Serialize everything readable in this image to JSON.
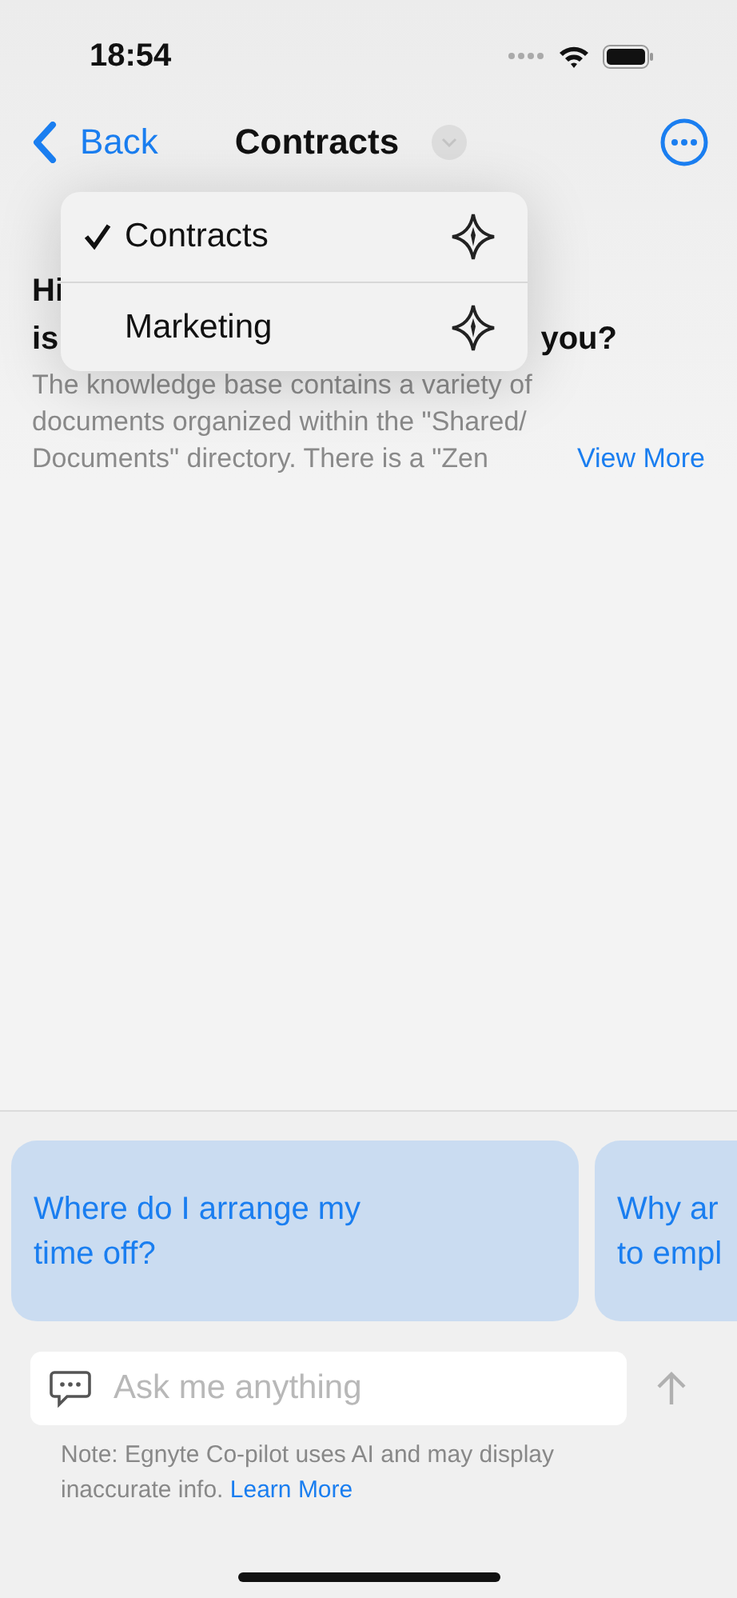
{
  "status_bar": {
    "time": "18:54"
  },
  "nav": {
    "back": "Back",
    "title": "Contracts"
  },
  "menu": {
    "items": [
      {
        "label": "Contracts",
        "selected": true
      },
      {
        "label": "Marketing",
        "selected": false
      }
    ]
  },
  "greeting": {
    "line_1": "Hi",
    "line_2_start": "is",
    "line_2_end": "you?"
  },
  "summary": {
    "lines": [
      "The knowledge base contains a variety of",
      "documents organized within the \"Shared/",
      "Documents\" directory. There is a \"Zen"
    ],
    "more": "View More"
  },
  "suggestions": [
    {
      "lines": [
        "Where do I arrange my",
        "time off?"
      ]
    },
    {
      "lines": [
        "Why ar",
        "to empl"
      ]
    }
  ],
  "input": {
    "placeholder": "Ask me anything"
  },
  "note": {
    "text": "Note: Egnyte Co-pilot uses AI and may display inaccurate info.",
    "link": "Learn More"
  }
}
